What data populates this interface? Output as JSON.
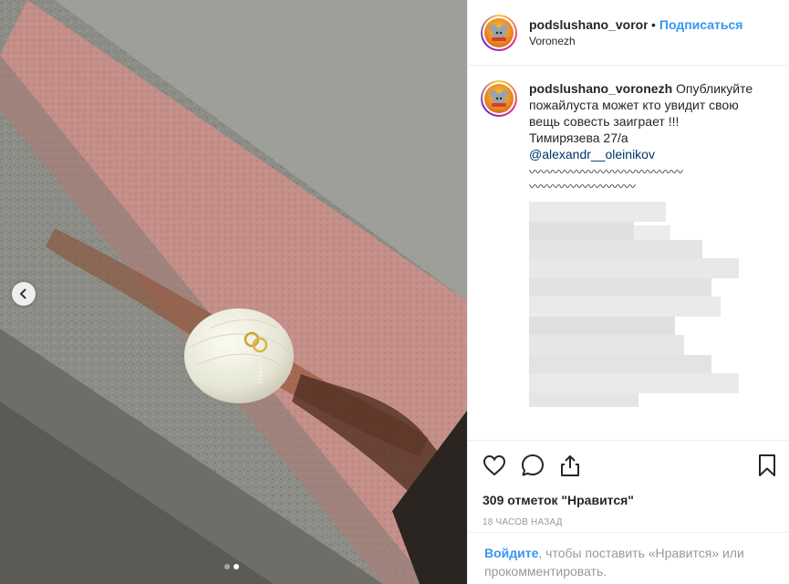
{
  "header": {
    "username": "podslushano_voronezh",
    "bullet": "•",
    "follow_label": "Подписаться",
    "location": "Voronezh"
  },
  "caption": {
    "username": "podslushano_voronezh",
    "text_line1": "Опубликуйте пожайлуста может кто увидит свою вещь совесть заиграет !!!",
    "text_line2": "Тимирязева 27/а",
    "mention": "@alexandr__oleinikov",
    "tilde_line1": "〰〰〰〰〰〰〰〰〰〰〰〰〰",
    "tilde_line2": "〰〰〰〰〰〰〰〰〰"
  },
  "actions": {
    "likes": "309 отметок \"Нравится\"",
    "time": "18 часов назад"
  },
  "login": {
    "link": "Войдите",
    "text": ", чтобы поставить «Нравится» или прокомментировать."
  },
  "colors": {
    "link_blue": "#3897f0",
    "mention_blue": "#003569",
    "concrete": "#8a8a86",
    "pink_ledge": "#c89089"
  },
  "carousel": {
    "prev_icon": "chevron-left-icon"
  }
}
